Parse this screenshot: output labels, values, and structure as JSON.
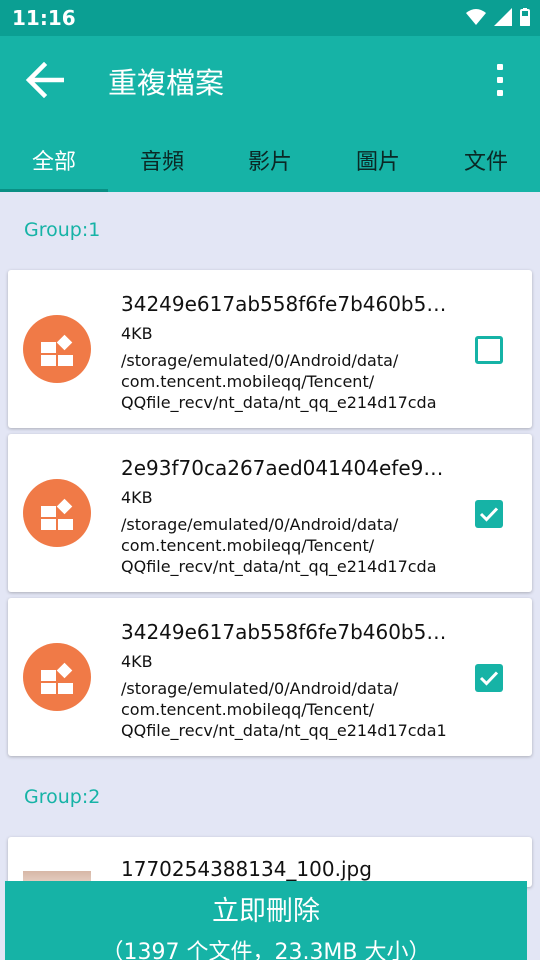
{
  "status_bar": {
    "time": "11:16",
    "icons": [
      "wifi-icon",
      "signal-icon",
      "battery-icon"
    ]
  },
  "app_bar": {
    "title": "重複檔案",
    "back_icon": "arrow-left-icon",
    "menu_icon": "more-vertical-icon"
  },
  "tabs": [
    {
      "label": "全部",
      "active": true
    },
    {
      "label": "音頻",
      "active": false
    },
    {
      "label": "影片",
      "active": false
    },
    {
      "label": "圖片",
      "active": false
    },
    {
      "label": "文件",
      "active": false
    }
  ],
  "groups": [
    {
      "label": "Group:1",
      "items": [
        {
          "name": "34249e617ab558f6fe7b460b5…",
          "size": "4KB",
          "path_lines": [
            "/storage/emulated/0/Android/data/",
            "com.tencent.mobileqq/Tencent/",
            "QQfile_recv/nt_data/nt_qq_e214d17cda"
          ],
          "checked": false
        },
        {
          "name": "2e93f70ca267aed041404efe9…",
          "size": "4KB",
          "path_lines": [
            "/storage/emulated/0/Android/data/",
            "com.tencent.mobileqq/Tencent/",
            "QQfile_recv/nt_data/nt_qq_e214d17cda"
          ],
          "checked": true
        },
        {
          "name": "34249e617ab558f6fe7b460b5…",
          "size": "4KB",
          "path_lines": [
            "/storage/emulated/0/Android/data/",
            "com.tencent.mobileqq/Tencent/",
            "QQfile_recv/nt_data/nt_qq_e214d17cda1"
          ],
          "checked": true
        }
      ]
    },
    {
      "label": "Group:2",
      "items": [
        {
          "name": "1770254388134_100.jpg"
        }
      ]
    }
  ],
  "delete_button": {
    "title": "立即刪除",
    "subtitle": "（1397 个文件，23.3MB 大小）"
  },
  "colors": {
    "primary": "#16b3a6",
    "status_bar": "#0b9f93",
    "background": "#e3e6f5",
    "file_icon": "#f07a47"
  }
}
